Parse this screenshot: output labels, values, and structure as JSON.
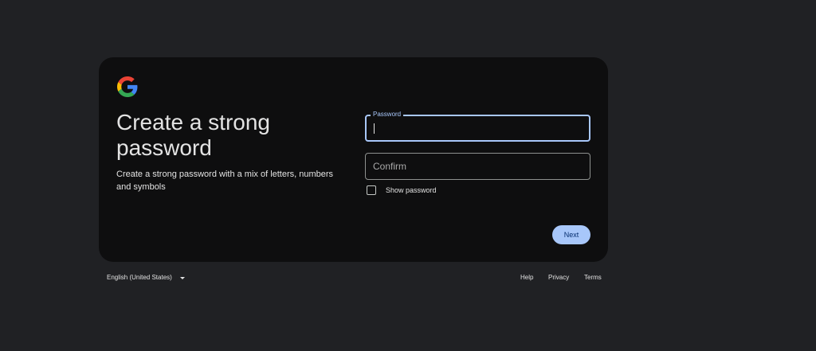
{
  "card": {
    "logo_icon": "google-g-logo",
    "title": "Create a strong password",
    "subtitle": "Create a strong password with a mix of letters, numbers and symbols"
  },
  "form": {
    "password_label": "Password",
    "password_value": "",
    "confirm_placeholder": "Confirm",
    "confirm_value": "",
    "show_password_label": "Show password",
    "show_password_checked": false,
    "next_label": "Next"
  },
  "footer": {
    "language": "English (United States)",
    "links": [
      "Help",
      "Privacy",
      "Terms"
    ]
  },
  "colors": {
    "page_background": "#202124",
    "card_background": "#0e0e0f",
    "accent": "#a8c7fa",
    "button_text": "#062e6f"
  }
}
